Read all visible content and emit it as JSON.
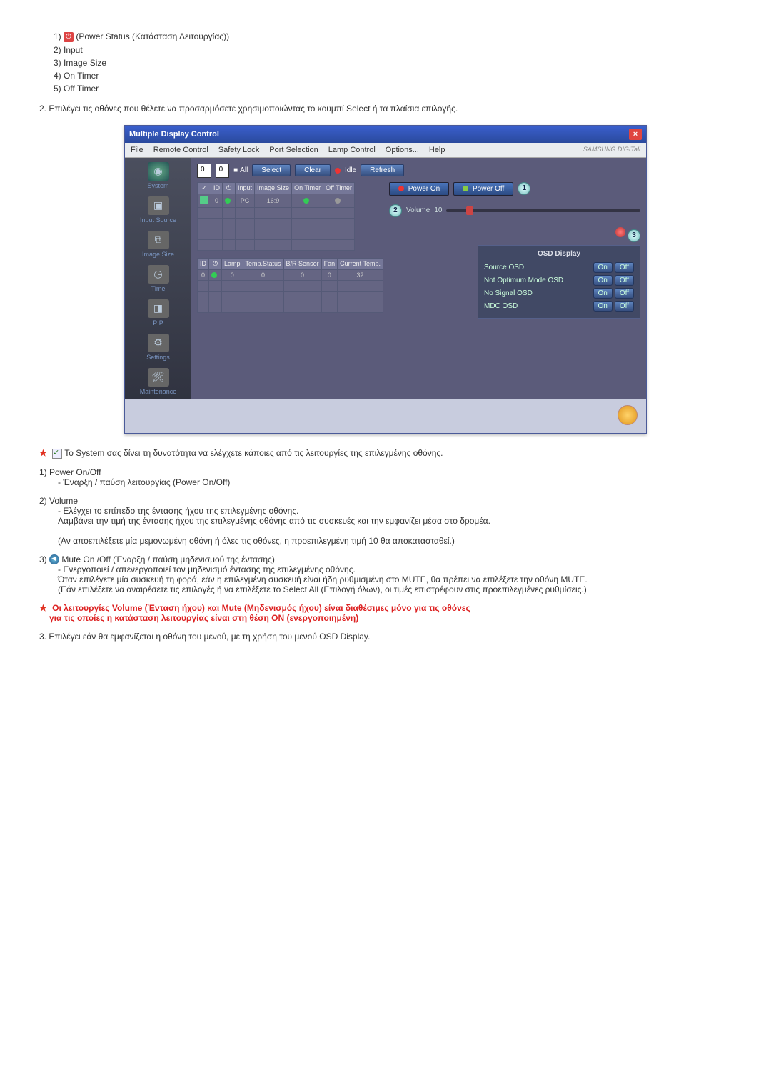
{
  "topList": {
    "l1_prefix": "1) ",
    "l1_icon_alt": "power-status-icon",
    "l1_text": " (Power Status (Κατάσταση Λειτουργίας))",
    "l2": "2) Input",
    "l3": "3) Image Size",
    "l4": "4) On Timer",
    "l5": "5) Off Timer"
  },
  "instruction2": "2.  Επιλέγει τις οθόνες που θέλετε να προσαρμόσετε χρησιμοποιώντας το κουμπί Select ή τα πλαίσια επιλογής.",
  "app": {
    "title": "Multiple Display Control",
    "menus": {
      "file": "File",
      "remote": "Remote Control",
      "safety": "Safety Lock",
      "port": "Port Selection",
      "lamp": "Lamp Control",
      "options": "Options...",
      "help": "Help",
      "brand": "SAMSUNG DIGITall"
    },
    "sidebar": {
      "system": "System",
      "input": "Input Source",
      "image": "Image Size",
      "time": "Time",
      "pip": "PIP",
      "settings": "Settings",
      "maint": "Maintenance"
    },
    "ctrl": {
      "drop1": "0",
      "drop2": "0",
      "all": "All",
      "select": "Select",
      "clear": "Clear",
      "idle": "Idle",
      "refresh": "Refresh"
    },
    "tableTop": {
      "h_id": "ID",
      "h_input": "Input",
      "h_size": "Image Size",
      "h_on": "On Timer",
      "h_off": "Off Timer",
      "row_id": "0",
      "row_input": "PC",
      "row_size": "16:9"
    },
    "tableBottom": {
      "h_id": "ID",
      "h_lamp": "Lamp",
      "h_temp": "Temp.Status",
      "h_br": "B/R Sensor",
      "h_fan": "Fan",
      "h_ctemp": "Current Temp.",
      "r_id": "0",
      "r_lamp": "0",
      "r_temp": "0",
      "r_br": "0",
      "r_fan": "0",
      "r_ctemp": "32"
    },
    "right": {
      "power_on": "Power On",
      "power_off": "Power Off",
      "bubble1": "1",
      "volume_label": "Volume",
      "volume_value": "10",
      "bubble2": "2",
      "bubble3": "3",
      "osd_title": "OSD Display",
      "osd_rows": {
        "source": "Source OSD",
        "notopt": "Not Optimum Mode OSD",
        "nosig": "No Signal OSD",
        "mdc": "MDC OSD"
      },
      "on": "On",
      "off": "Off"
    }
  },
  "lower": {
    "system_note": "Το System σας δίνει τη δυνατότητα να ελέγχετε κάποιες από τις λειτουργίες της επιλεγμένης οθόνης.",
    "p1_title": "1)  Power On/Off",
    "p1_l1": "- Έναρξη / παύση λειτουργίας (Power On/Off)",
    "p2_title": "2)  Volume",
    "p2_l1": "- Ελέγχει το επίπεδο της έντασης ήχου της επιλεγμένης οθόνης.",
    "p2_l2": "Λαμβάνει την τιμή της έντασης ήχου της επιλεγμένης οθόνης από τις συσκευές και την εμφανίζει μέσα στο δρομέα.",
    "p2_l3": "(Αν αποεπιλέξετε μία μεμονωμένη οθόνη ή όλες τις οθόνες, η προεπιλεγμένη τιμή 10 θα αποκατασταθεί.)",
    "p3_prefix": "3) ",
    "p3_title": " Mute On /Off (Έναρξη / παύση μηδενισμού της έντασης)",
    "p3_l1": "- Ενεργοποιεί / απενεργοποιεί τον μηδενισμό έντασης της επιλεγμένης οθόνης.",
    "p3_l2": "Όταν επιλέγετε μία συσκευή τη φορά, εάν η επιλεγμένη συσκευή είναι ήδη ρυθμισμένη στο MUTE, θα πρέπει να επιλέξετε την οθόνη MUTE.",
    "p3_l3": "(Εάν επιλέξετε να αναιρέσετε τις επιλογές ή να επιλέξετε το Select All (Επιλογή όλων), οι τιμές επιστρέφουν στις προεπιλεγμένες ρυθμίσεις.)",
    "warn_l1": "Οι λειτουργίες Volume (Ένταση ήχου) και Mute (Μηδενισμός ήχου) είναι διαθέσιμες μόνο για τις οθόνες",
    "warn_l2": "για τις οποίες η κατάσταση λειτουργίας είναι στη θέση ON (ενεργοποιημένη)",
    "p4": "3.  Επιλέγει εάν θα εμφανίζεται η οθόνη του μενού, με τη χρήση του μενού OSD Display."
  }
}
